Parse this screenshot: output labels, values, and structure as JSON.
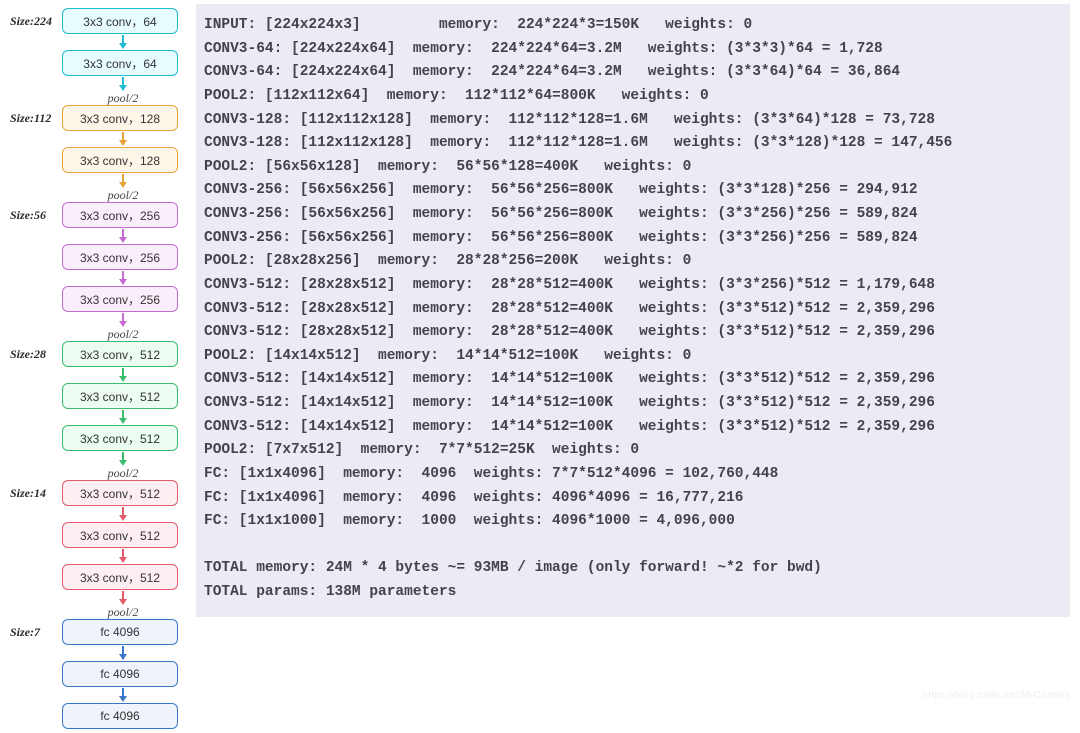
{
  "left": {
    "groups": [
      {
        "size": "Size:224",
        "color": "g1",
        "arrow": "a1",
        "blocks": [
          "3x3 conv，64",
          "3x3 conv，64"
        ],
        "after": "pool/2"
      },
      {
        "size": "Size:112",
        "color": "g2",
        "arrow": "a2",
        "blocks": [
          "3x3 conv，128",
          "3x3 conv，128"
        ],
        "after": "pool/2"
      },
      {
        "size": "Size:56",
        "color": "g3",
        "arrow": "a3",
        "blocks": [
          "3x3 conv，256",
          "3x3 conv，256",
          "3x3 conv，256"
        ],
        "after": "pool/2"
      },
      {
        "size": "Size:28",
        "color": "g4",
        "arrow": "a4",
        "blocks": [
          "3x3 conv，512",
          "3x3 conv，512",
          "3x3 conv，512"
        ],
        "after": "pool/2"
      },
      {
        "size": "Size:14",
        "color": "g5",
        "arrow": "a5",
        "blocks": [
          "3x3 conv，512",
          "3x3 conv，512",
          "3x3 conv，512"
        ],
        "after": "pool/2"
      },
      {
        "size": "Size:7",
        "color": "g6",
        "arrow": "a6",
        "blocks": [
          "fc 4096",
          "fc 4096",
          "fc 4096"
        ],
        "after": null
      }
    ]
  },
  "lines": [
    "INPUT: [224x224x3]         memory:  224*224*3=150K   weights: 0",
    "CONV3-64: [224x224x64]  memory:  224*224*64=3.2M   weights: (3*3*3)*64 = 1,728",
    "CONV3-64: [224x224x64]  memory:  224*224*64=3.2M   weights: (3*3*64)*64 = 36,864",
    "POOL2: [112x112x64]  memory:  112*112*64=800K   weights: 0",
    "CONV3-128: [112x112x128]  memory:  112*112*128=1.6M   weights: (3*3*64)*128 = 73,728",
    "CONV3-128: [112x112x128]  memory:  112*112*128=1.6M   weights: (3*3*128)*128 = 147,456",
    "POOL2: [56x56x128]  memory:  56*56*128=400K   weights: 0",
    "CONV3-256: [56x56x256]  memory:  56*56*256=800K   weights: (3*3*128)*256 = 294,912",
    "CONV3-256: [56x56x256]  memory:  56*56*256=800K   weights: (3*3*256)*256 = 589,824",
    "CONV3-256: [56x56x256]  memory:  56*56*256=800K   weights: (3*3*256)*256 = 589,824",
    "POOL2: [28x28x256]  memory:  28*28*256=200K   weights: 0",
    "CONV3-512: [28x28x512]  memory:  28*28*512=400K   weights: (3*3*256)*512 = 1,179,648",
    "CONV3-512: [28x28x512]  memory:  28*28*512=400K   weights: (3*3*512)*512 = 2,359,296",
    "CONV3-512: [28x28x512]  memory:  28*28*512=400K   weights: (3*3*512)*512 = 2,359,296",
    "POOL2: [14x14x512]  memory:  14*14*512=100K   weights: 0",
    "CONV3-512: [14x14x512]  memory:  14*14*512=100K   weights: (3*3*512)*512 = 2,359,296",
    "CONV3-512: [14x14x512]  memory:  14*14*512=100K   weights: (3*3*512)*512 = 2,359,296",
    "CONV3-512: [14x14x512]  memory:  14*14*512=100K   weights: (3*3*512)*512 = 2,359,296",
    "POOL2: [7x7x512]  memory:  7*7*512=25K  weights: 0",
    "FC: [1x1x4096]  memory:  4096  weights: 7*7*512*4096 = 102,760,448",
    "FC: [1x1x4096]  memory:  4096  weights: 4096*4096 = 16,777,216",
    "FC: [1x1x1000]  memory:  1000  weights: 4096*1000 = 4,096,000",
    "",
    "TOTAL memory: 24M * 4 bytes ~= 93MB / image (only forward! ~*2 for bwd)",
    "TOTAL params: 138M parameters"
  ],
  "watermark": "https://blog.csdn.net/MrCharles"
}
